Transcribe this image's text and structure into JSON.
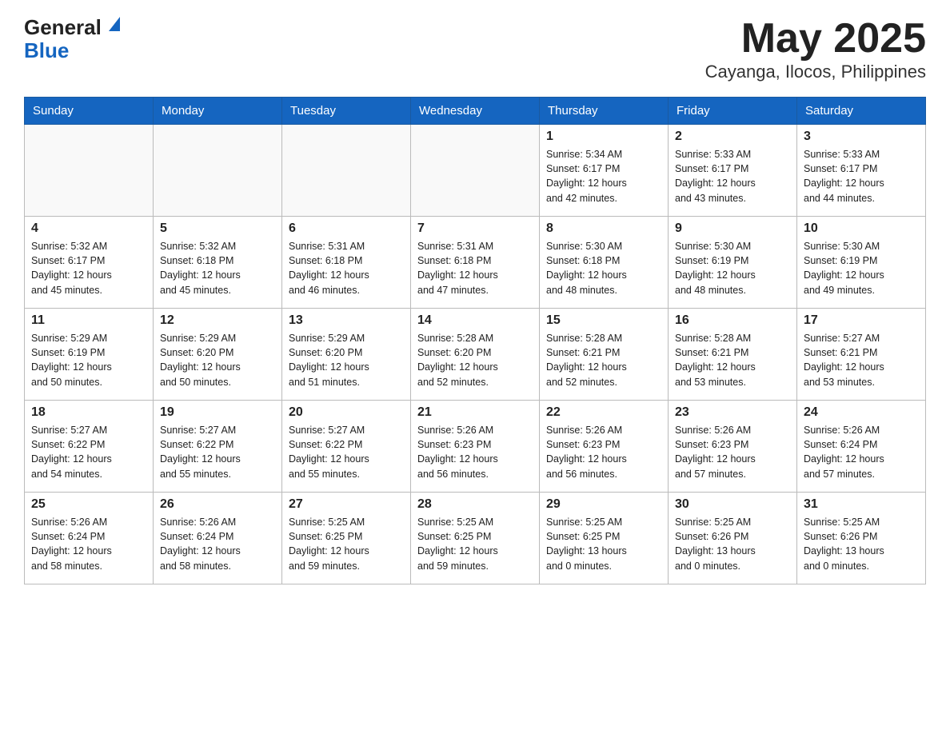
{
  "header": {
    "logo_general": "General",
    "logo_blue": "Blue",
    "title": "May 2025",
    "subtitle": "Cayanga, Ilocos, Philippines"
  },
  "days_of_week": [
    "Sunday",
    "Monday",
    "Tuesday",
    "Wednesday",
    "Thursday",
    "Friday",
    "Saturday"
  ],
  "weeks": [
    [
      {
        "day": "",
        "info": ""
      },
      {
        "day": "",
        "info": ""
      },
      {
        "day": "",
        "info": ""
      },
      {
        "day": "",
        "info": ""
      },
      {
        "day": "1",
        "info": "Sunrise: 5:34 AM\nSunset: 6:17 PM\nDaylight: 12 hours\nand 42 minutes."
      },
      {
        "day": "2",
        "info": "Sunrise: 5:33 AM\nSunset: 6:17 PM\nDaylight: 12 hours\nand 43 minutes."
      },
      {
        "day": "3",
        "info": "Sunrise: 5:33 AM\nSunset: 6:17 PM\nDaylight: 12 hours\nand 44 minutes."
      }
    ],
    [
      {
        "day": "4",
        "info": "Sunrise: 5:32 AM\nSunset: 6:17 PM\nDaylight: 12 hours\nand 45 minutes."
      },
      {
        "day": "5",
        "info": "Sunrise: 5:32 AM\nSunset: 6:18 PM\nDaylight: 12 hours\nand 45 minutes."
      },
      {
        "day": "6",
        "info": "Sunrise: 5:31 AM\nSunset: 6:18 PM\nDaylight: 12 hours\nand 46 minutes."
      },
      {
        "day": "7",
        "info": "Sunrise: 5:31 AM\nSunset: 6:18 PM\nDaylight: 12 hours\nand 47 minutes."
      },
      {
        "day": "8",
        "info": "Sunrise: 5:30 AM\nSunset: 6:18 PM\nDaylight: 12 hours\nand 48 minutes."
      },
      {
        "day": "9",
        "info": "Sunrise: 5:30 AM\nSunset: 6:19 PM\nDaylight: 12 hours\nand 48 minutes."
      },
      {
        "day": "10",
        "info": "Sunrise: 5:30 AM\nSunset: 6:19 PM\nDaylight: 12 hours\nand 49 minutes."
      }
    ],
    [
      {
        "day": "11",
        "info": "Sunrise: 5:29 AM\nSunset: 6:19 PM\nDaylight: 12 hours\nand 50 minutes."
      },
      {
        "day": "12",
        "info": "Sunrise: 5:29 AM\nSunset: 6:20 PM\nDaylight: 12 hours\nand 50 minutes."
      },
      {
        "day": "13",
        "info": "Sunrise: 5:29 AM\nSunset: 6:20 PM\nDaylight: 12 hours\nand 51 minutes."
      },
      {
        "day": "14",
        "info": "Sunrise: 5:28 AM\nSunset: 6:20 PM\nDaylight: 12 hours\nand 52 minutes."
      },
      {
        "day": "15",
        "info": "Sunrise: 5:28 AM\nSunset: 6:21 PM\nDaylight: 12 hours\nand 52 minutes."
      },
      {
        "day": "16",
        "info": "Sunrise: 5:28 AM\nSunset: 6:21 PM\nDaylight: 12 hours\nand 53 minutes."
      },
      {
        "day": "17",
        "info": "Sunrise: 5:27 AM\nSunset: 6:21 PM\nDaylight: 12 hours\nand 53 minutes."
      }
    ],
    [
      {
        "day": "18",
        "info": "Sunrise: 5:27 AM\nSunset: 6:22 PM\nDaylight: 12 hours\nand 54 minutes."
      },
      {
        "day": "19",
        "info": "Sunrise: 5:27 AM\nSunset: 6:22 PM\nDaylight: 12 hours\nand 55 minutes."
      },
      {
        "day": "20",
        "info": "Sunrise: 5:27 AM\nSunset: 6:22 PM\nDaylight: 12 hours\nand 55 minutes."
      },
      {
        "day": "21",
        "info": "Sunrise: 5:26 AM\nSunset: 6:23 PM\nDaylight: 12 hours\nand 56 minutes."
      },
      {
        "day": "22",
        "info": "Sunrise: 5:26 AM\nSunset: 6:23 PM\nDaylight: 12 hours\nand 56 minutes."
      },
      {
        "day": "23",
        "info": "Sunrise: 5:26 AM\nSunset: 6:23 PM\nDaylight: 12 hours\nand 57 minutes."
      },
      {
        "day": "24",
        "info": "Sunrise: 5:26 AM\nSunset: 6:24 PM\nDaylight: 12 hours\nand 57 minutes."
      }
    ],
    [
      {
        "day": "25",
        "info": "Sunrise: 5:26 AM\nSunset: 6:24 PM\nDaylight: 12 hours\nand 58 minutes."
      },
      {
        "day": "26",
        "info": "Sunrise: 5:26 AM\nSunset: 6:24 PM\nDaylight: 12 hours\nand 58 minutes."
      },
      {
        "day": "27",
        "info": "Sunrise: 5:25 AM\nSunset: 6:25 PM\nDaylight: 12 hours\nand 59 minutes."
      },
      {
        "day": "28",
        "info": "Sunrise: 5:25 AM\nSunset: 6:25 PM\nDaylight: 12 hours\nand 59 minutes."
      },
      {
        "day": "29",
        "info": "Sunrise: 5:25 AM\nSunset: 6:25 PM\nDaylight: 13 hours\nand 0 minutes."
      },
      {
        "day": "30",
        "info": "Sunrise: 5:25 AM\nSunset: 6:26 PM\nDaylight: 13 hours\nand 0 minutes."
      },
      {
        "day": "31",
        "info": "Sunrise: 5:25 AM\nSunset: 6:26 PM\nDaylight: 13 hours\nand 0 minutes."
      }
    ]
  ]
}
